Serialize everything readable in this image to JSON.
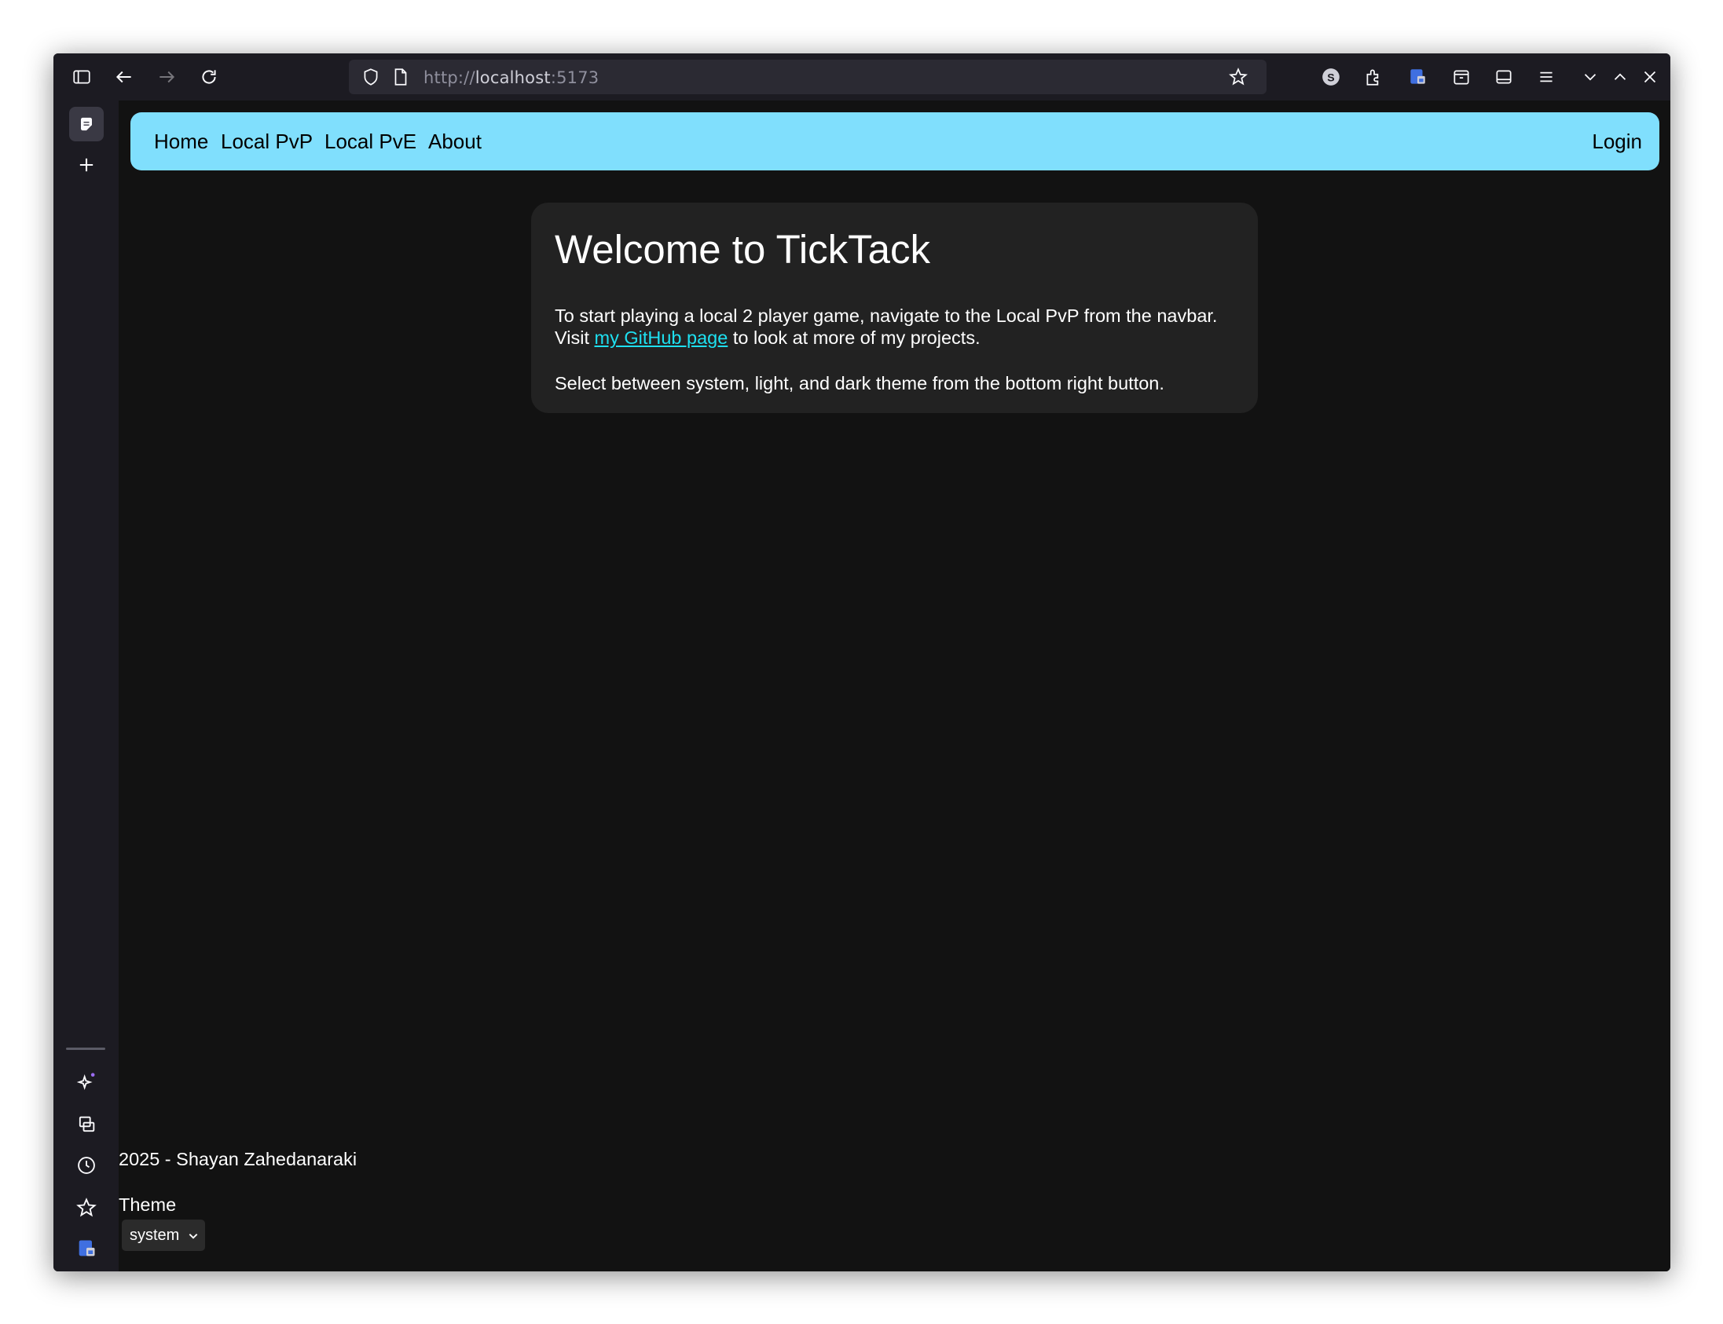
{
  "browser": {
    "url_prefix": "http://",
    "url_host": "localhost",
    "url_suffix": ":5173",
    "extension_badge": "S"
  },
  "navbar": {
    "links": [
      "Home",
      "Local PvP",
      "Local PvE",
      "About"
    ],
    "login": "Login"
  },
  "card": {
    "title": "Welcome to TickTack",
    "intro": "To start playing a local 2 player game, navigate to the Local PvP from the navbar.",
    "visit_prefix": "Visit ",
    "github_link": "my GitHub page",
    "visit_suffix": " to look at more of my projects.",
    "theme_hint": "Select between system, light, and dark theme from the bottom right button."
  },
  "footer": {
    "copyright": "2025 - Shayan Zahedanaraki",
    "theme_label": "Theme",
    "theme_value": "system"
  }
}
